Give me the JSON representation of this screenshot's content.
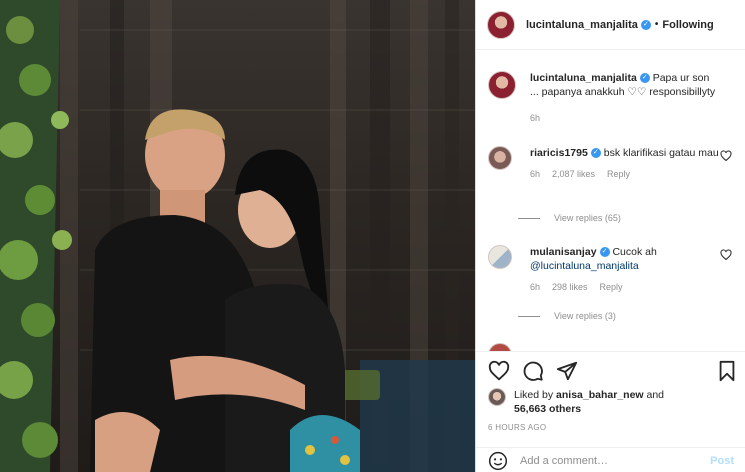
{
  "post": {
    "author": "lucintaluna_manjalita",
    "follow_status": "Following",
    "caption_user": "lucintaluna_manjalita",
    "caption_text": "Papa ur son ... papanya anakkuh ♡♡ responsibillyty",
    "caption_time": "6h"
  },
  "comments": [
    {
      "user": "riaricis1795",
      "text": "bsk klarifikasi gatau mau",
      "time": "6h",
      "likes": "2,087 likes",
      "reply": "Reply",
      "view_replies": "View replies (65)"
    },
    {
      "user": "mulanisanjay",
      "text": "Cucok ah",
      "mention": "@lucintaluna_manjalita",
      "time": "6h",
      "likes": "298 likes",
      "reply": "Reply",
      "view_replies": "View replies (3)"
    }
  ],
  "engagement": {
    "liked_by_prefix": "Liked by",
    "liked_by_user": "anisa_bahar_new",
    "and": "and",
    "others_count": "56,663 others",
    "time_ago": "6 HOURS AGO"
  },
  "comment_box": {
    "placeholder": "Add a comment…",
    "post_label": "Post"
  },
  "icons": {
    "like": "heart-icon",
    "comment": "comment-icon",
    "share": "share-icon",
    "save": "bookmark-icon",
    "emoji": "emoji-icon"
  },
  "colors": {
    "verified": "#3897f0",
    "link": "#00376b",
    "muted": "#8e8e8e",
    "post_button": "#b2dffc"
  }
}
